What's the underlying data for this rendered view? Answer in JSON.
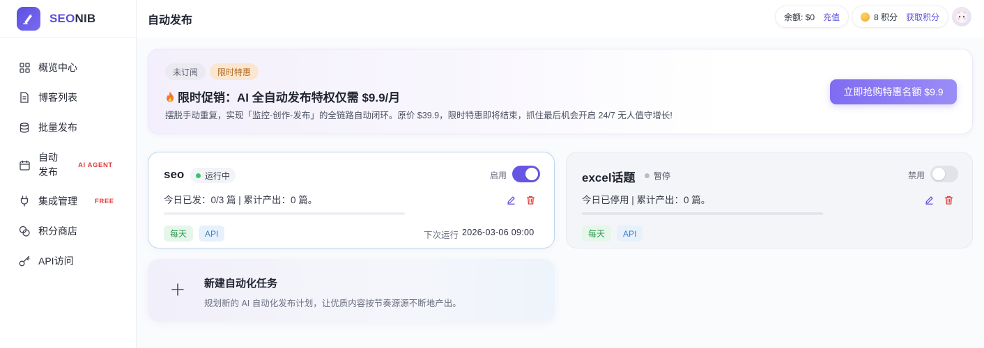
{
  "brand": {
    "name_part1": "SEO",
    "name_part2": "NIB"
  },
  "sidebar": {
    "items": [
      {
        "label": "概览中心",
        "icon": "grid-icon"
      },
      {
        "label": "博客列表",
        "icon": "document-icon"
      },
      {
        "label": "批量发布",
        "icon": "database-icon"
      },
      {
        "label": "自动发布",
        "icon": "calendar-icon",
        "badge": "AI AGENT",
        "active": true
      },
      {
        "label": "集成管理",
        "icon": "plug-icon",
        "badge": "FREE"
      },
      {
        "label": "积分商店",
        "icon": "coins-icon"
      },
      {
        "label": "API访问",
        "icon": "key-icon"
      }
    ]
  },
  "header": {
    "title": "自动发布",
    "balance_label": "余额: $0",
    "recharge_label": "充值",
    "points_label": "8 积分",
    "get_points_label": "获取积分"
  },
  "promo": {
    "tag_unsubscribed": "未订阅",
    "tag_limited": "限时特惠",
    "title": "限时促销：AI 全自动发布特权仅需 $9.9/月",
    "description": "摆脱手动重复，实现「监控-创作-发布」的全链路自动闭环。原价 $39.9，限时特惠即将结束，抓住最后机会开启 24/7 无人值守增长!",
    "button": "立即抢购特惠名额 $9.9"
  },
  "tasks": [
    {
      "name": "seo",
      "status": "运行中",
      "toggle_label": "启用",
      "enabled": true,
      "stats": "今日已发：0/3 篇 | 累计产出：0 篇。",
      "progress": 0,
      "chips": [
        "每天",
        "API"
      ],
      "next_run_label": "下次运行",
      "next_run_time": "2026-03-06 09:00"
    },
    {
      "name": "excel话题",
      "status": "暂停",
      "toggle_label": "禁用",
      "enabled": false,
      "stats": "今日已停用 | 累计产出：0 篇。",
      "progress": 0,
      "chips": [
        "每天",
        "API"
      ]
    }
  ],
  "new_task": {
    "title": "新建自动化任务",
    "description": "规划新的 AI 自动化发布计划，让优质内容按节奏源源不断地产出。"
  },
  "colors": {
    "accent": "#6657e3",
    "running": "#3ac46a",
    "danger": "#e23b3b"
  }
}
